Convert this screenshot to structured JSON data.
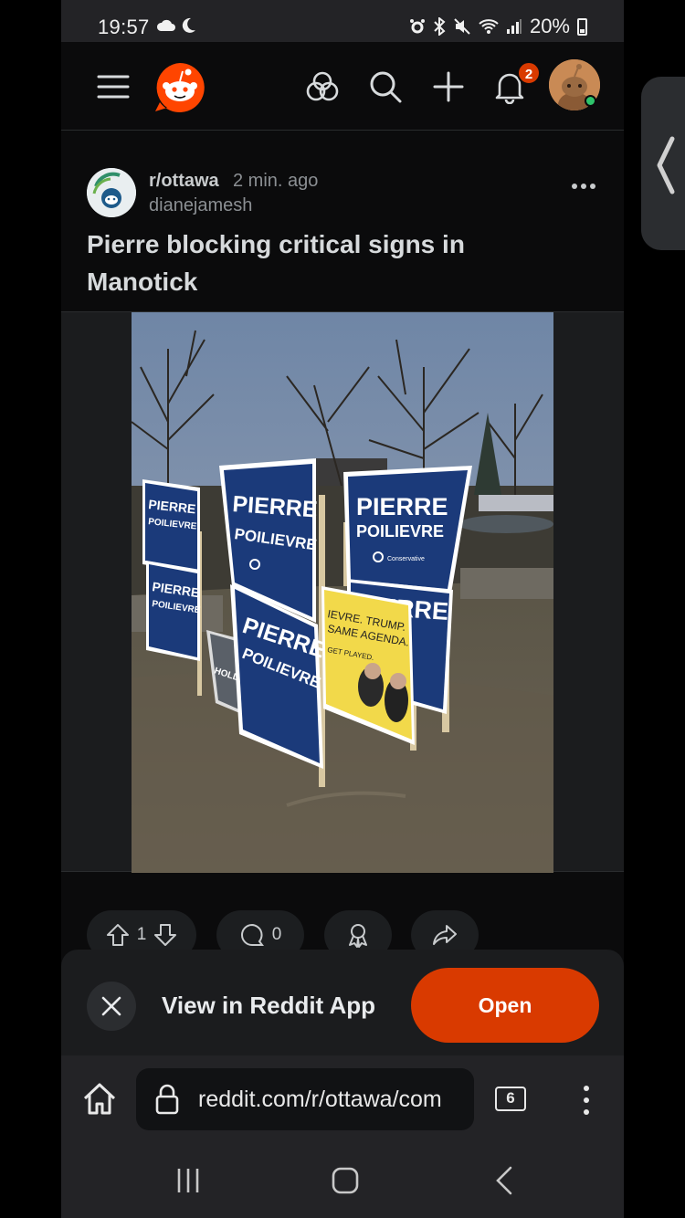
{
  "status_bar": {
    "time": "19:57",
    "battery": "20%",
    "left_icons": [
      "cloud-icon",
      "moon-icon"
    ],
    "right_icons": [
      "alarm-icon",
      "bluetooth-icon",
      "mute-icon",
      "wifi-icon",
      "signal-icon",
      "battery-icon"
    ]
  },
  "header": {
    "notification_count": "2",
    "icons": [
      "menu-icon",
      "reddit-logo",
      "explore-icon",
      "search-icon",
      "create-icon",
      "bell-icon",
      "avatar"
    ]
  },
  "post": {
    "subreddit": "r/ottawa",
    "time": "2 min. ago",
    "author": "dianejamesh",
    "title": "Pierre blocking critical signs in Manotick",
    "image_signs": {
      "sign_first": "PIERRE",
      "sign_last": "POILIEVRE",
      "sign_party": "Conservative",
      "yellow_sign_line1": "IEVRE. TRUMP.",
      "yellow_sign_line2": "SAME AGENDA.",
      "yellow_sign_line3": "GET PLAYED.",
      "grey_sign": "HOLLINGER"
    },
    "upvotes": "1",
    "comments": "0"
  },
  "banner": {
    "text": "View in Reddit App",
    "open_label": "Open"
  },
  "browser": {
    "url": "reddit.com/r/ottawa/com",
    "tab_count": "6"
  },
  "colors": {
    "accent": "#d93a00",
    "background": "#0b0b0c",
    "surface": "#1b1c1e",
    "sign_blue": "#1b3a7a",
    "sign_yellow": "#f2d94a"
  }
}
